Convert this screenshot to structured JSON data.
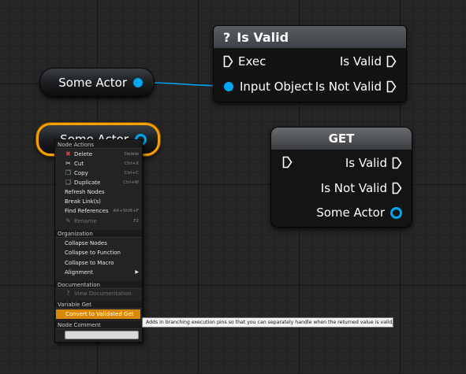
{
  "colors": {
    "object_pin": "#00a8f3",
    "selection": "#f5a000",
    "menu_highlight": "#d98900",
    "graph_bg": "#262626"
  },
  "nodes": {
    "some_actor_top": {
      "label": "Some Actor"
    },
    "some_actor_selected": {
      "label": "Some Actor"
    },
    "is_valid": {
      "title": "Is Valid",
      "title_icon": "?",
      "exec_in": "Exec",
      "is_valid_out": "Is Valid",
      "input_object": "Input Object",
      "is_not_valid_out": "Is Not Valid"
    },
    "get": {
      "title": "GET",
      "is_valid_out": "Is Valid",
      "is_not_valid_out": "Is Not Valid",
      "some_actor_out": "Some Actor"
    }
  },
  "context_menu": {
    "node_actions_header": "Node Actions",
    "delete": {
      "label": "Delete",
      "shortcut": "Delete",
      "icon": "delete-icon"
    },
    "cut": {
      "label": "Cut",
      "shortcut": "Ctrl+X",
      "icon": "cut-icon"
    },
    "copy": {
      "label": "Copy",
      "shortcut": "Ctrl+C",
      "icon": "copy-icon"
    },
    "duplicate": {
      "label": "Duplicate",
      "shortcut": "Ctrl+W",
      "icon": "duplicate-icon"
    },
    "refresh_nodes": "Refresh Nodes",
    "break_links": "Break Link(s)",
    "find_references": {
      "label": "Find References",
      "shortcut": "Alt+Shift+F"
    },
    "rename": {
      "label": "Rename",
      "shortcut": "F2",
      "icon": "rename-icon"
    },
    "organization_header": "Organization",
    "collapse_nodes": "Collapse Nodes",
    "collapse_to_function": "Collapse to Function",
    "collapse_to_macro": "Collapse to Macro",
    "alignment": "Alignment",
    "documentation_header": "Documentation",
    "view_documentation": {
      "label": "View Documentation",
      "icon": "help-icon"
    },
    "variable_get_header": "Variable Get",
    "convert_to_validated_get": "Convert to Validated Get",
    "node_comment_header": "Node Comment"
  },
  "tooltip": "Adds in branching execution pins so that you can separately handle when the returned value is valid/invalid."
}
